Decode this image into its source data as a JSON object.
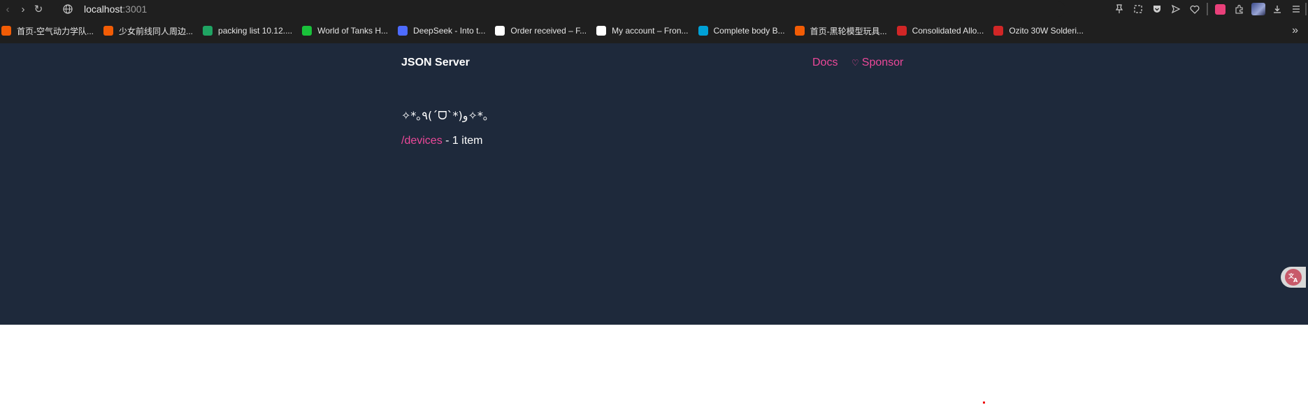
{
  "browser": {
    "url_host": "localhost",
    "url_port": ":3001",
    "toolbar_icons": [
      "pin-icon",
      "screenshot-icon",
      "pocket-icon",
      "send-icon",
      "heart-icon",
      "translate-ext-icon",
      "extensions-icon",
      "profile-avatar",
      "download-icon",
      "menu-icon"
    ]
  },
  "bookmarks": [
    {
      "label": "首页-空气动力学队...",
      "color": "#f25c05"
    },
    {
      "label": "少女前线同人周边...",
      "color": "#f25c05"
    },
    {
      "label": "packing list 10.12....",
      "color": "#1fa463"
    },
    {
      "label": "World of Tanks H...",
      "color": "#19c13a"
    },
    {
      "label": "DeepSeek - Into t...",
      "color": "#4d6bfe"
    },
    {
      "label": "Order received – F...",
      "color": "#ffffff"
    },
    {
      "label": "My account – Fron...",
      "color": "#ffffff"
    },
    {
      "label": "Complete body B...",
      "color": "#00a1d6"
    },
    {
      "label": "首页-黑轮模型玩具...",
      "color": "#f25c05"
    },
    {
      "label": "Consolidated Allo...",
      "color": "#d12626"
    },
    {
      "label": "Ozito 30W Solderi...",
      "color": "#d12626"
    }
  ],
  "page": {
    "brand": "JSON Server",
    "nav": {
      "docs": "Docs",
      "sponsor": "Sponsor",
      "sponsor_icon": "♡"
    },
    "kaomoji": "✧*｡٩(ˊᗜˋ*)و✧*｡",
    "resource": {
      "link": "/devices",
      "count_text": " - 1 item"
    }
  }
}
